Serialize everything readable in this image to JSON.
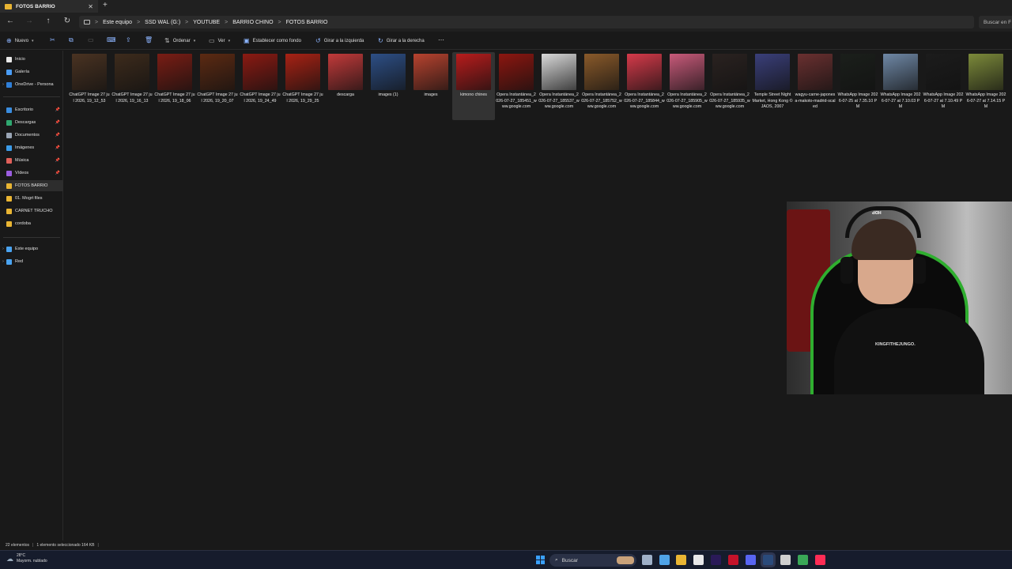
{
  "tab": {
    "title": "FOTOS BARRIO",
    "close": "✕",
    "new": "+"
  },
  "nav": {
    "back": "←",
    "forward": "→",
    "up": "↑",
    "refresh": "↻"
  },
  "breadcrumb": [
    "Este equipo",
    "SSD WAL (G:)",
    "YOUTUBE",
    "BARRIO CHINO",
    "FOTOS BARRIO"
  ],
  "crumb_sep": ">",
  "search": {
    "placeholder": "Buscar en F"
  },
  "commands": {
    "new": "Nuevo",
    "sort": "Ordenar",
    "view": "Ver",
    "set_background": "Establecer como fondo",
    "rotate_left": "Girar a la izquierda",
    "rotate_right": "Girar a la derecha",
    "more": "⋯"
  },
  "sidebar": {
    "items": [
      {
        "label": "Inicio",
        "color": "#e8e8e8",
        "pin": ""
      },
      {
        "label": "Galería",
        "color": "#4a9cf5",
        "pin": ""
      },
      {
        "label": "OneDrive - Persona",
        "color": "#2f7fd8",
        "pin": ""
      },
      {
        "label": "Escritorio",
        "color": "#3a8de0",
        "pin": "📌"
      },
      {
        "label": "Descargas",
        "color": "#2fa870",
        "pin": "📌"
      },
      {
        "label": "Documentos",
        "color": "#9aa5b5",
        "pin": "📌"
      },
      {
        "label": "Imágenes",
        "color": "#3b9be8",
        "pin": "📌"
      },
      {
        "label": "Música",
        "color": "#e0605a",
        "pin": "📌"
      },
      {
        "label": "Vídeos",
        "color": "#9b5de0",
        "pin": "📌"
      },
      {
        "label": "FOTOS BARRIO",
        "color": "#e9b533",
        "pin": ""
      },
      {
        "label": "01. Mogrt files",
        "color": "#e9b533",
        "pin": ""
      },
      {
        "label": "CARNET TRUCHO",
        "color": "#e9b533",
        "pin": ""
      },
      {
        "label": "cordoba",
        "color": "#e9b533",
        "pin": ""
      },
      {
        "label": "Este equipo",
        "color": "#4aa3f0",
        "pin": ""
      },
      {
        "label": "Red",
        "color": "#4aa3f0",
        "pin": ""
      }
    ],
    "chevron": "›"
  },
  "files": [
    {
      "name": "ChatGPT Image 27 jul 2026, 19_12_53",
      "thumb": "#4a3322"
    },
    {
      "name": "ChatGPT Image 27 jul 2026, 19_16_13",
      "thumb": "#3d2b1c"
    },
    {
      "name": "ChatGPT Image 27 jul 2026, 19_18_06",
      "thumb": "#7a1d14"
    },
    {
      "name": "ChatGPT Image 27 jul 2026, 19_20_07",
      "thumb": "#5c2a12"
    },
    {
      "name": "ChatGPT Image 27 jul 2026, 19_24_49",
      "thumb": "#8b1a12"
    },
    {
      "name": "ChatGPT Image 27 jul 2026, 19_29_25",
      "thumb": "#a82214"
    },
    {
      "name": "descarga",
      "thumb": "#c23a3a"
    },
    {
      "name": "images (1)",
      "thumb": "#2d4f86"
    },
    {
      "name": "images",
      "thumb": "#b8432f"
    },
    {
      "name": "kimono chines",
      "thumb": "#b81c1c"
    },
    {
      "name": "Opera Instantánea_2026-07-27_185451_www.google.com",
      "thumb": "#8c1610"
    },
    {
      "name": "Opera Instantánea_2026-07-27_185537_www.google.com",
      "thumb": "#d9d9d9"
    },
    {
      "name": "Opera Instantánea_2026-07-27_185752_www.google.com",
      "thumb": "#8a5a2a"
    },
    {
      "name": "Opera Instantánea_2026-07-27_185844_www.google.com",
      "thumb": "#d63a4a"
    },
    {
      "name": "Opera Instantánea_2026-07-27_185905_www.google.com",
      "thumb": "#c85a7a"
    },
    {
      "name": "Opera Instantánea_2026-07-27_185935_www.google.com",
      "thumb": "#2a2220"
    },
    {
      "name": "Temple Street Night Market, Hong Kong © JAOS, 2007",
      "thumb": "#3a3f7a"
    },
    {
      "name": "wagyu-carne-japonesa-makoto-madrid-scaled",
      "thumb": "#6a3030"
    },
    {
      "name": "WhatsApp Image 2026-07-25 at 7.35.10 PM",
      "thumb": "#1b1f1b"
    },
    {
      "name": "WhatsApp Image 2026-07-27 at 7.10.03 PM",
      "thumb": "#6f88a6"
    },
    {
      "name": "WhatsApp Image 2026-07-27 at 7.10.49 PM",
      "thumb": "#1c1c1c"
    },
    {
      "name": "WhatsApp Image 2026-07-27 at 7.14.15 PM",
      "thumb": "#7c8a3a"
    }
  ],
  "selected_file_index": 9,
  "webcam": {
    "cap_text": "HDP",
    "shirt_text": "KINGFITHEJUNGO."
  },
  "status": {
    "count": "22 elementos",
    "selection": "1 elemento seleccionado  164 KB"
  },
  "taskbar": {
    "weather_temp": "28°C",
    "weather_desc": "Mayorm. nublado",
    "search": "Buscar",
    "apps": [
      {
        "name": "task-view",
        "color": "#9fb0c8"
      },
      {
        "name": "copilot",
        "color": "#4fa3e8"
      },
      {
        "name": "file-explorer",
        "color": "#e9b533"
      },
      {
        "name": "notepad",
        "color": "#e8e8e8"
      },
      {
        "name": "premiere",
        "color": "#2a1a58"
      },
      {
        "name": "opera",
        "color": "#c4122a"
      },
      {
        "name": "discord",
        "color": "#5865f2"
      },
      {
        "name": "steam",
        "color": "#2a4a7a"
      },
      {
        "name": "capcut",
        "color": "#cfcfcf"
      },
      {
        "name": "chrome",
        "color": "#3aa757"
      },
      {
        "name": "tiktok",
        "color": "#fe2c55"
      }
    ]
  }
}
